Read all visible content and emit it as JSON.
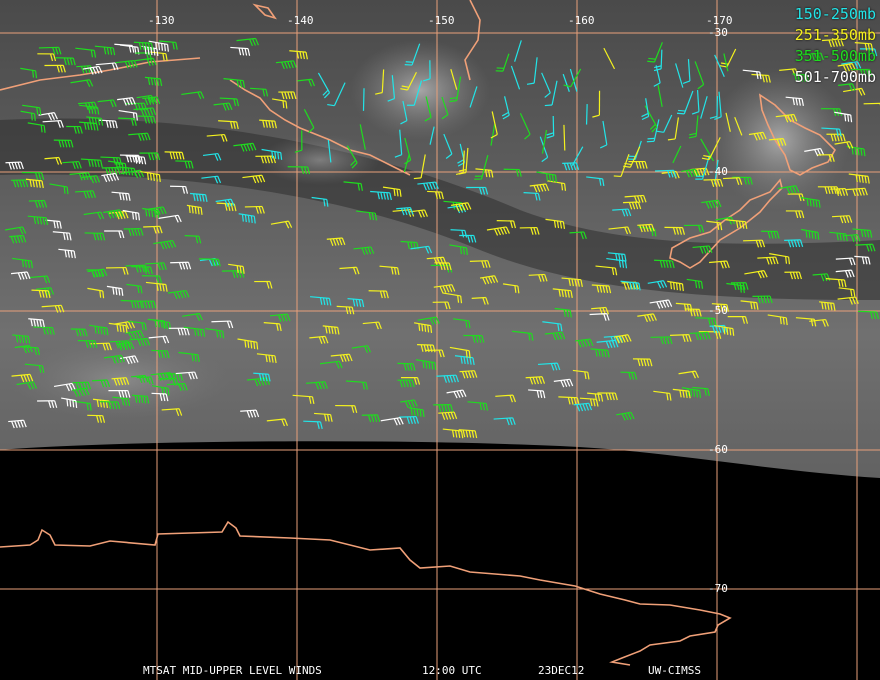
{
  "legend": [
    {
      "label": "150-250mb",
      "color": "#22e5e8"
    },
    {
      "label": "251-350mb",
      "color": "#f4f21e"
    },
    {
      "label": "351-500mb",
      "color": "#1fdc1f"
    },
    {
      "label": "501-700mb",
      "color": "#ffffff"
    }
  ],
  "longitude_labels": [
    "-130",
    "-140",
    "-150",
    "-160",
    "-170"
  ],
  "latitude_labels": [
    "-30",
    "-40",
    "-50",
    "-60",
    "-70"
  ],
  "footer": {
    "product": "MTSAT MID-UPPER LEVEL WINDS",
    "time": "12:00 UTC",
    "date": "23DEC12",
    "source": "UW-CIMSS"
  },
  "colors": {
    "grid": "#e8a07a",
    "coast": "#f0a078",
    "background": "#000000"
  }
}
